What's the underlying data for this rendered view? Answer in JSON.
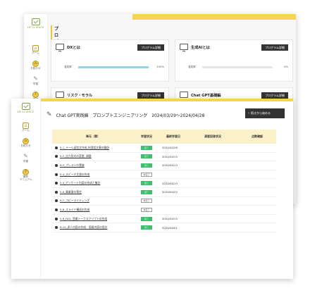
{
  "brand": {
    "logo_text": "LM SCIENCE"
  },
  "back_sidebar": [
    {
      "icon": "⌂",
      "label": "ホーム"
    },
    {
      "icon": "⚠",
      "label": "お知らせ"
    },
    {
      "icon": "✎",
      "label": "学習"
    },
    {
      "icon": "?",
      "label": "操作"
    }
  ],
  "front_sidebar": [
    {
      "icon": "⌂",
      "label": "ホーム"
    },
    {
      "icon": "⚠",
      "label": "お知らせ"
    },
    {
      "icon": "✎",
      "label": "学習"
    },
    {
      "icon": "?",
      "label": "操作\nマニュアル"
    }
  ],
  "program_list": {
    "heading": "プログラム一覧",
    "cards": [
      {
        "title": "DXとは",
        "button": "プログラム詳細",
        "progress_label": "達成率",
        "progress": 100,
        "progress_text": "100%"
      },
      {
        "title": "生成AIとは",
        "button": "プログラム詳細",
        "progress_label": "達成率",
        "progress": 0,
        "progress_text": "0%"
      },
      {
        "title": "リスク・モラル",
        "button": "プログラム詳細"
      },
      {
        "title": "Chat GPT基礎編",
        "button": "プログラム詳細"
      }
    ]
  },
  "course": {
    "title": "Chat GPT実践編　プロンプトエンジニアリング　2024/03/29〜2024/04/28",
    "resume_button": "続きから始める",
    "columns": [
      "単元（章）",
      "学習状況",
      "最終学習日",
      "演習回答状況",
      "点数確認"
    ],
    "rows": [
      {
        "lesson": "5-1_メール返信文作成,外国語文章の翻訳",
        "status": "完了",
        "date": "2024/04/26",
        "done": true
      },
      {
        "lesson": "5-2_出力形式の変更, 調整",
        "status": "完了",
        "date": "2024/04/13",
        "done": true
      },
      {
        "lesson": "5-3_プレストの実施",
        "status": "完了",
        "date": "2024/04/13",
        "done": true
      },
      {
        "lesson": "5-4_スピーチ文書の作成",
        "status": "未完了",
        "date": "",
        "done": false
      },
      {
        "lesson": "5-5_アンケート内容の作成と集計",
        "status": "完了",
        "date": "2024/04/13",
        "done": true
      },
      {
        "lesson": "5-6_事業案の策定",
        "status": "完了",
        "date": "2024/04/22",
        "done": true
      },
      {
        "lesson": "5-7_コピーライティング",
        "status": "未完了",
        "date": "",
        "done": false
      },
      {
        "lesson": "5-8_スライド構成の作成",
        "status": "未完了",
        "date": "",
        "done": false
      },
      {
        "lesson": "5-9_FAQ, 営業トークスクリプトの作成",
        "status": "完了",
        "date": "2024/04/13",
        "done": true
      },
      {
        "lesson": "5-10_求人内容の作成、面接内容の設計",
        "status": "完了",
        "date": "2024/04/01",
        "done": true
      }
    ]
  }
}
